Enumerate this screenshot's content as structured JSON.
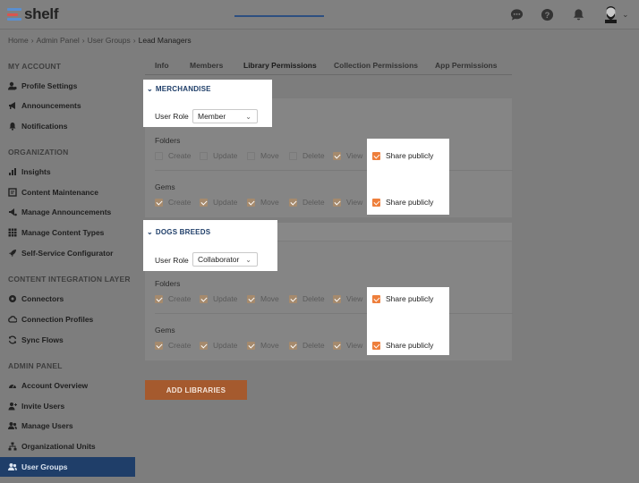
{
  "app": {
    "name": "shelf"
  },
  "breadcrumb": [
    "Home",
    "Admin Panel",
    "User Groups",
    "Lead Managers"
  ],
  "sidebar": {
    "sections": [
      {
        "title": "MY ACCOUNT",
        "items": [
          "Profile Settings",
          "Announcements",
          "Notifications"
        ]
      },
      {
        "title": "ORGANIZATION",
        "items": [
          "Insights",
          "Content Maintenance",
          "Manage Announcements",
          "Manage Content Types",
          "Self-Service Configurator"
        ]
      },
      {
        "title": "CONTENT INTEGRATION LAYER",
        "items": [
          "Connectors",
          "Connection Profiles",
          "Sync Flows"
        ]
      },
      {
        "title": "ADMIN PANEL",
        "items": [
          "Account Overview",
          "Invite Users",
          "Manage Users",
          "Organizational Units",
          "User Groups"
        ]
      }
    ],
    "active_item": "User Groups"
  },
  "tabs": [
    "Info",
    "Members",
    "Library Permissions",
    "Collection Permissions",
    "App Permissions"
  ],
  "active_tab": "Library Permissions",
  "libraries": [
    {
      "name": "MERCHANDISE",
      "role_label": "User Role",
      "role": "Member",
      "rows": [
        {
          "label": "Folders",
          "perms": [
            "Create",
            "Update",
            "Move",
            "Delete",
            "View"
          ],
          "checked": [
            false,
            false,
            false,
            false,
            true
          ],
          "share": "Share publicly",
          "share_checked": true
        },
        {
          "label": "Gems",
          "perms": [
            "Create",
            "Update",
            "Move",
            "Delete",
            "View"
          ],
          "checked": [
            true,
            true,
            true,
            true,
            true
          ],
          "share": "Share publicly",
          "share_checked": true
        }
      ]
    },
    {
      "name": "DOGS BREEDS",
      "role_label": "User Role",
      "role": "Collaborator",
      "rows": [
        {
          "label": "Folders",
          "perms": [
            "Create",
            "Update",
            "Move",
            "Delete",
            "View"
          ],
          "checked": [
            true,
            true,
            true,
            true,
            true
          ],
          "share": "Share publicly",
          "share_checked": true
        },
        {
          "label": "Gems",
          "perms": [
            "Create",
            "Update",
            "Move",
            "Delete",
            "View"
          ],
          "checked": [
            true,
            true,
            true,
            true,
            true
          ],
          "share": "Share publicly",
          "share_checked": true
        }
      ]
    }
  ],
  "add_button": "ADD LIBRARIES",
  "icons": [
    "chat-icon",
    "help-icon",
    "bell-icon",
    "avatar",
    "chevron-down-icon"
  ],
  "colors": {
    "accent": "#ee7f3c",
    "nav_active": "#1f3e69",
    "button": "#a55a2e"
  }
}
